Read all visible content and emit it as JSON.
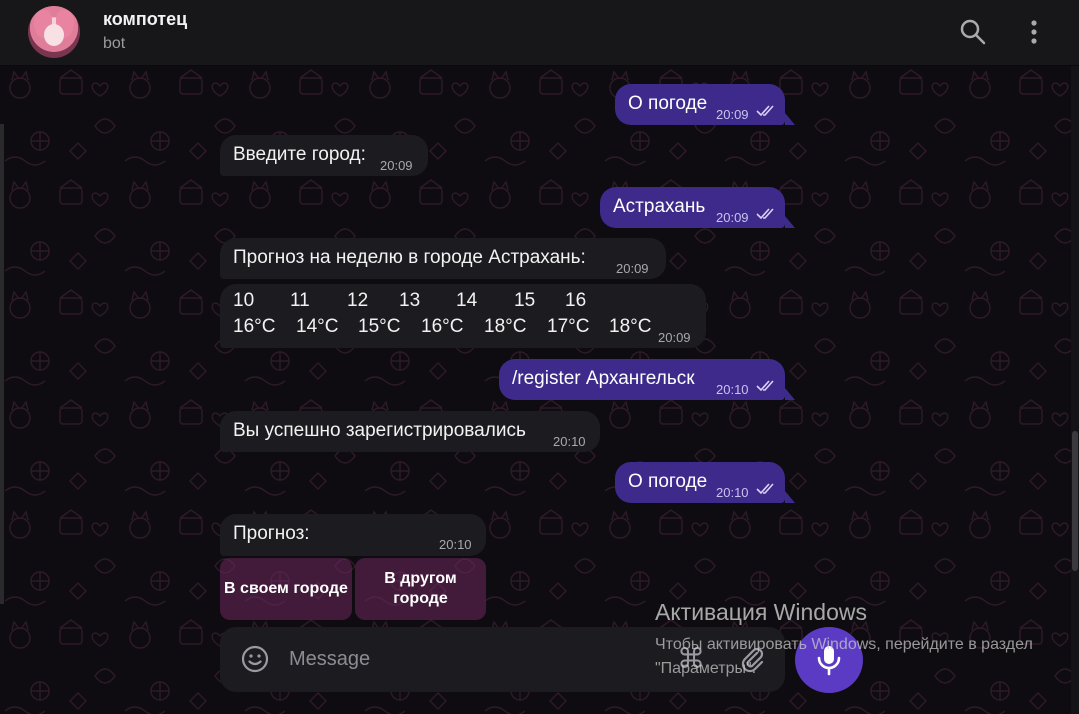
{
  "header": {
    "title": "компотец",
    "subtitle": "bot"
  },
  "messages": [
    {
      "text": "О погоде",
      "time": "20:09"
    },
    {
      "text": "Введите город:",
      "time": "20:09"
    },
    {
      "text": "Астрахань",
      "time": "20:09"
    },
    {
      "text": "Прогноз на неделю в городе Астрахань:",
      "time": "20:09"
    },
    {
      "days": [
        "10",
        "11",
        "12",
        "13",
        "14",
        "15",
        "16"
      ],
      "temps": [
        "16°C",
        "14°C",
        "15°C",
        "16°C",
        "18°C",
        "17°C",
        "18°C"
      ],
      "time": "20:09"
    },
    {
      "text": "/register Архангельск",
      "time": "20:10"
    },
    {
      "text": "Вы успешно зарегистрировались",
      "time": "20:10"
    },
    {
      "text": "О погоде",
      "time": "20:10"
    },
    {
      "text": "Прогноз:",
      "time": "20:10"
    }
  ],
  "keyboard": {
    "btn1": "В своем городе",
    "btn2": "В другом городе"
  },
  "composer": {
    "placeholder": "Message"
  },
  "watermark": {
    "title": "Активация Windows",
    "text": "Чтобы активировать Windows, перейдите в раздел \"Параметры\"."
  }
}
